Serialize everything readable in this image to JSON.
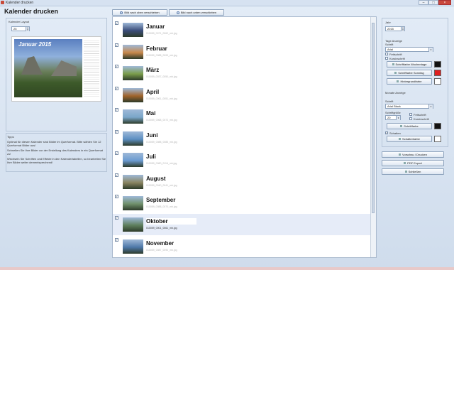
{
  "window": {
    "title": "Kalender drucken",
    "min": "–",
    "max": "□",
    "close": "×"
  },
  "app_title": "Kalender drucken",
  "toolbar": {
    "move_up": "Bild nach oben verschieben",
    "move_down": "Bild nach unten verschieben"
  },
  "left": {
    "layout_label": "Kalender Layout",
    "layout_value": "25",
    "preview_title": "Januar 2015",
    "tipps_title": "Tipps",
    "tipps_text_1": "Optimal für diesen Kalender sind Bilder im Querformat. Bitte wählen Sie 12 Querformat Bilder aus!",
    "tipps_text_2": "Schnellen Sie Ihre Bilder vor der Erstellung des Kalenders in ein Querformat zu!",
    "tipps_text_3": "Wechseln Sie Schriften und Effekte in den Kalendertabellen, so bearbeiten Sie Ihre Bilder weiter dementsprechend!"
  },
  "months": [
    {
      "name": "Januar",
      "file": "010059_0071_0062_mb.jpg",
      "checked": true
    },
    {
      "name": "Februar",
      "file": "010059_0088_0093_mb.jpg",
      "checked": true
    },
    {
      "name": "März",
      "file": "010059_0037_0050_mb.jpg",
      "checked": true
    },
    {
      "name": "April",
      "file": "010059_0061_0051_mb.jpg",
      "checked": true
    },
    {
      "name": "Mai",
      "file": "010059_0068_0072_mb.jpg",
      "checked": true
    },
    {
      "name": "Juni",
      "file": "010059_0088_0085_mb.jpg",
      "checked": true
    },
    {
      "name": "Juli",
      "file": "010059_0080_0116_mb.jpg",
      "checked": true
    },
    {
      "name": "August",
      "file": "010059_0040_0041_mb.jpg",
      "checked": true
    },
    {
      "name": "September",
      "file": "010059_0088_0070_mb.jpg",
      "checked": true
    },
    {
      "name": "Oktober",
      "file": "010059_0001_0061_mb.jpg",
      "checked": true
    },
    {
      "name": "November",
      "file": "010059_0087_0090_mb.jpg",
      "checked": true
    }
  ],
  "right": {
    "jahr_label": "Jahr",
    "jahr_value": "2015",
    "tage_label": "Tage Anzeige",
    "schrift_label": "Schrift",
    "tage_font": "Arial",
    "fett_label": "Fettschrift",
    "kursiv_label": "Kursivschrift",
    "farbe_woche": "Schriftfarbe Wochentage",
    "farbe_sonntag": "Schriftfarbe Sonntag",
    "hintergrund": "Hintergrundfarbe",
    "monate_label": "Monate Anzeige",
    "monate_schrift_label": "Schrift",
    "monate_font": "Arial Black",
    "groesse_label": "Schriftgröße",
    "groesse_value": "20",
    "m_fett_label": "Fettschrift",
    "m_kursiv_label": "Kursivschrift",
    "m_farbe": "Schriftfarbe",
    "schatten_label": "Schatten",
    "schattenfarbe": "Schattenfarbe",
    "vorschau": "Vorschau / Drucken",
    "pdf": "PDF Export",
    "schliessen": "Schließen"
  },
  "colors": {
    "woche": "#111111",
    "sonntag": "#e02020",
    "hintergrund": "#ffffff",
    "m_schrift": "#111111",
    "schatten": "#ffffff"
  },
  "thumbs": [
    "#3b4d7a",
    "#c9894b",
    "#7a9c4a",
    "#a0632a",
    "#7aa6c9",
    "#5c8fc2",
    "#6b9bd1",
    "#8a8560",
    "#6f8f6a",
    "#5e7f5c",
    "#4d77a8"
  ]
}
